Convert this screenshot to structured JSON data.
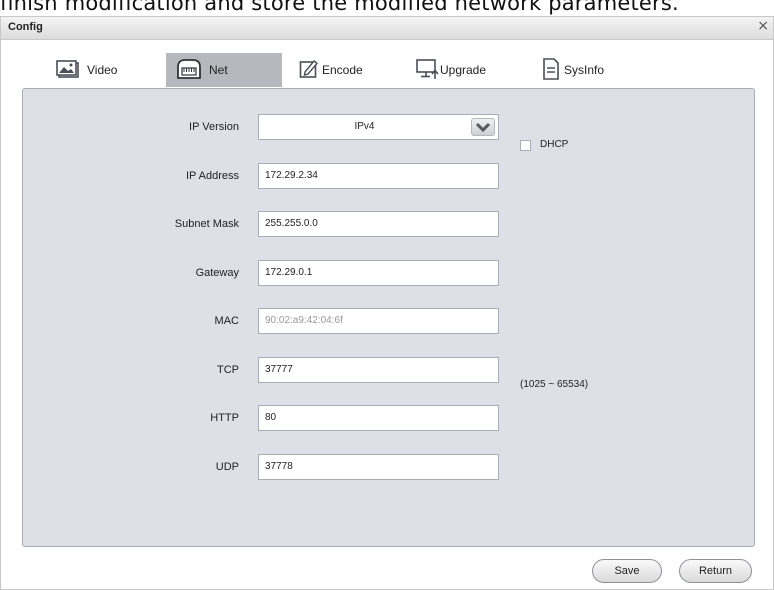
{
  "background_caption": "finish modification and store the modified network parameters.",
  "window": {
    "title": "Config",
    "close_glyph": "×"
  },
  "tabs": [
    {
      "label": "Video",
      "icon": "image-icon",
      "active": false
    },
    {
      "label": "Net",
      "icon": "network-icon",
      "active": true
    },
    {
      "label": "Encode",
      "icon": "edit-icon",
      "active": false
    },
    {
      "label": "Upgrade",
      "icon": "monitor-upgrade-icon",
      "active": false
    },
    {
      "label": "SysInfo",
      "icon": "document-icon",
      "active": false
    }
  ],
  "form": {
    "ip_version": {
      "label": "IP Version",
      "value": "IPv4"
    },
    "dhcp": {
      "label": "DHCP",
      "checked": false
    },
    "ip_address": {
      "label": "IP Address",
      "value": "172.29.2.34"
    },
    "subnet_mask": {
      "label": "Subnet Mask",
      "value": "255.255.0.0"
    },
    "gateway": {
      "label": "Gateway",
      "value": "172.29.0.1"
    },
    "mac": {
      "label": "MAC",
      "value": "90:02:a9:42:04:6f"
    },
    "tcp": {
      "label": "TCP",
      "value": "37777",
      "hint": "(1025 ~ 65534)"
    },
    "http": {
      "label": "HTTP",
      "value": "80"
    },
    "udp": {
      "label": "UDP",
      "value": "37778"
    }
  },
  "buttons": {
    "save": "Save",
    "return": "Return"
  },
  "colors": {
    "panel": "#dde0e6",
    "active_tab": "#b6b8bd",
    "titlebar": "#dcdcdc"
  }
}
